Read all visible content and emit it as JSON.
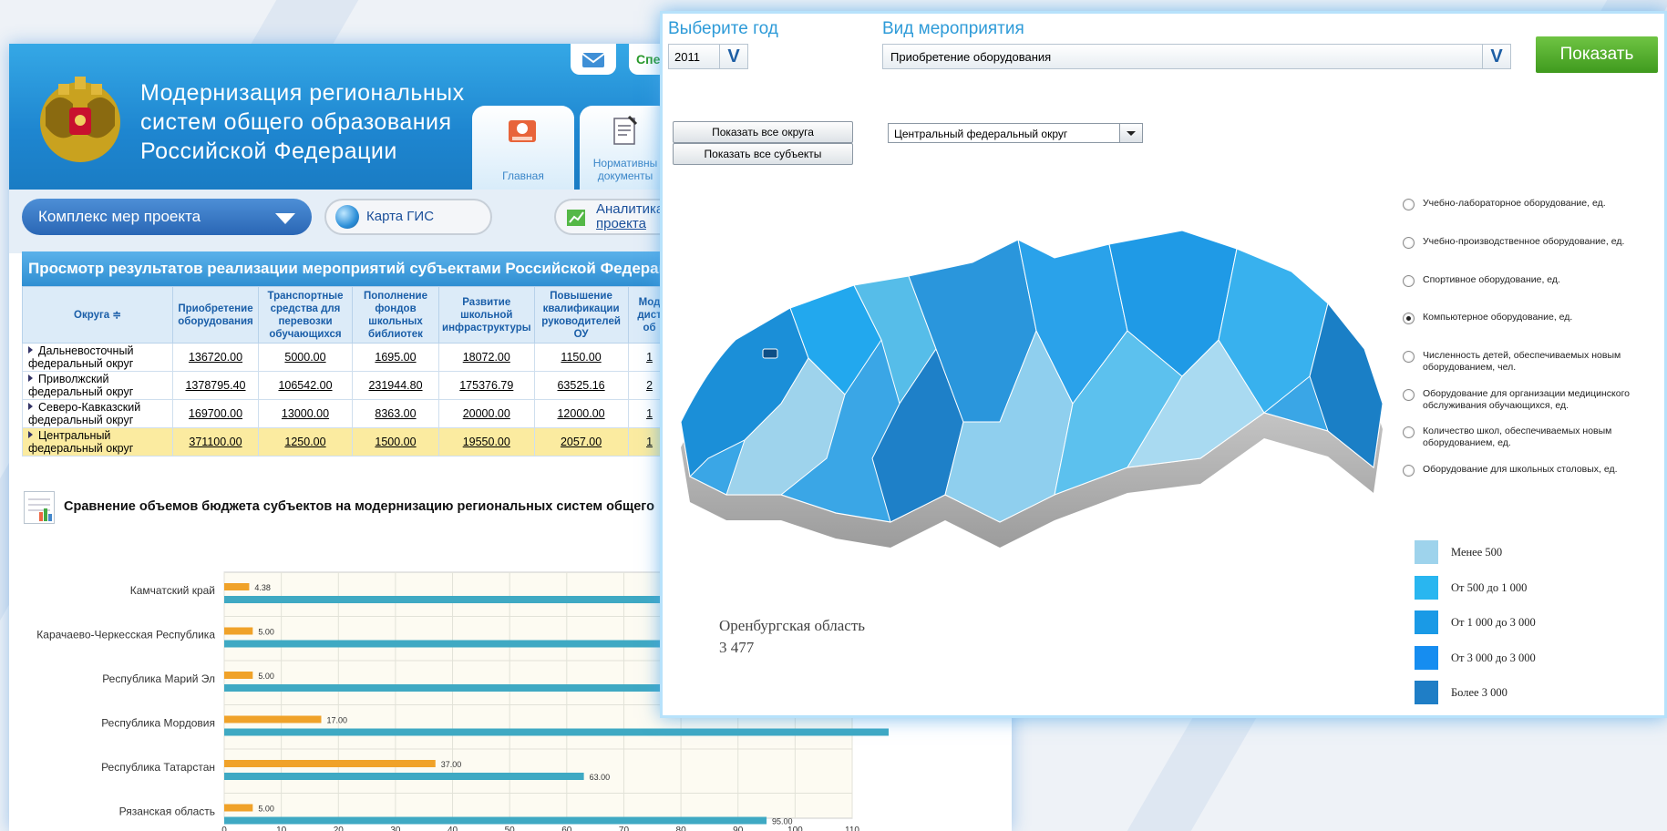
{
  "portal": {
    "title_lines": [
      "Модернизация региональных",
      "систем общего образования",
      "Российской Федерации"
    ],
    "spec_label": "Спе",
    "tabs": [
      {
        "label": "Главная"
      },
      {
        "label": "Нормативны"
      },
      {
        "label_line2": "документы"
      }
    ],
    "complex_button": "Комплекс мер проекта",
    "gis_button": "Карта ГИС",
    "analytics_button_line1": "Аналитика",
    "analytics_button_line2": "проекта",
    "section_title": "Просмотр результатов реализации мероприятий субъектами Российской Федерации",
    "table": {
      "columns": [
        "Округа ≑",
        "Приобретение оборудования",
        "Транспортные средства для перевозки обучающихся",
        "Пополнение фондов школьных библиотек",
        "Развитие школьной инфраструктуры",
        "Повышение квалификации руководителей ОУ",
        "Мод дист об"
      ],
      "rows": [
        {
          "region": "Дальневосточный федеральный округ",
          "values": [
            "136720.00",
            "5000.00",
            "1695.00",
            "18072.00",
            "1150.00",
            "1"
          ]
        },
        {
          "region": "Приволжский федеральный округ",
          "values": [
            "1378795.40",
            "106542.00",
            "231944.80",
            "175376.79",
            "63525.16",
            "2"
          ]
        },
        {
          "region": "Северо-Кавказский федеральный округ",
          "values": [
            "169700.00",
            "13000.00",
            "8363.00",
            "20000.00",
            "12000.00",
            "1"
          ]
        },
        {
          "region": "Центральный федеральный округ",
          "values": [
            "371100.00",
            "1250.00",
            "1500.00",
            "19550.00",
            "2057.00",
            "1"
          ]
        }
      ]
    },
    "compare_title": "Сравнение объемов бюджета субъектов на модернизацию региональных систем общего"
  },
  "chart_data": {
    "type": "bar",
    "orientation": "horizontal",
    "categories": [
      "Камчатский край",
      "Карачаево-Черкесская Республика",
      "Республика Марий Эл",
      "Республика Мордовия",
      "Республика Татарстан",
      "Рязанская область"
    ],
    "series": [
      {
        "values": [
          4.38,
          5.0,
          5.0,
          17.0,
          37.0,
          5.0
        ],
        "color": "#f0a229"
      },
      {
        "values": [
          null,
          null,
          null,
          null,
          63.0,
          95.0
        ],
        "color": "#3fa9c3"
      }
    ],
    "value_labels": [
      "4.38",
      "5.00",
      "5.00",
      "17.00",
      "37.00",
      "5.00",
      "63.00",
      "95.00"
    ],
    "ticks": [
      0,
      10,
      20,
      30,
      40,
      50,
      60,
      70,
      80,
      90,
      100,
      110
    ],
    "xlim": [
      0,
      110
    ],
    "grid": true
  },
  "map_panel": {
    "year_label": "Выберите год",
    "year_value": "2011",
    "event_label": "Вид мероприятия",
    "event_value": "Приобретение оборудования",
    "show_button": "Показать",
    "show_all_okrugs": "Показать все округа",
    "show_all_subjects": "Показать все субъекты",
    "okrug_select": "Центральный федеральный округ",
    "radio_options": [
      {
        "text": "Учебно-лабораторное оборудование, ед.",
        "selected": false
      },
      {
        "text": "Учебно-производственное оборудование, ед.",
        "selected": false
      },
      {
        "text": "Спортивное оборудование, ед.",
        "selected": false
      },
      {
        "text": "Компьютерное оборудование, ед.",
        "selected": true
      },
      {
        "text": "Численность детей, обеспечиваемых новым оборудованием, чел.",
        "selected": false
      },
      {
        "text": "Оборудование для организации медицинского обслуживания обучающихся, ед.",
        "selected": false
      },
      {
        "text": "Количество школ, обеспечиваемых новым оборудованием, ед.",
        "selected": false
      },
      {
        "text": "Оборудование для школьных столовых, ед.",
        "selected": false
      }
    ],
    "legend": [
      {
        "text": "Менее 500",
        "color": "#9ed3ec"
      },
      {
        "text": "От 500 до 1 000",
        "color": "#29b6f0"
      },
      {
        "text": "От 1 000 до 3 000",
        "color": "#1a9ae6"
      },
      {
        "text": "От 3 000 до 3 000",
        "color": "#168df0"
      },
      {
        "text": "Более 3 000",
        "color": "#1f7ec6"
      }
    ],
    "region_name": "Оренбургская область",
    "region_value": "3 477"
  }
}
